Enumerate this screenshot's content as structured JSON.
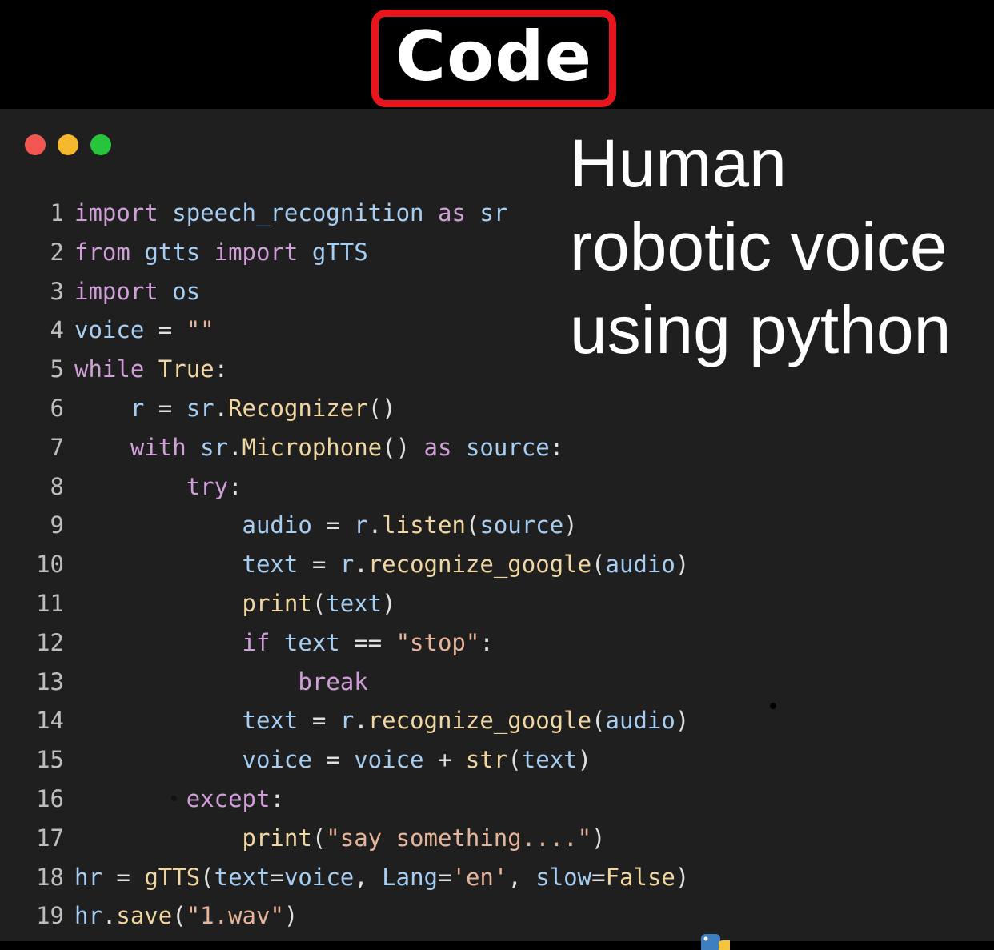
{
  "header": {
    "title": "Code"
  },
  "window": {
    "controls": [
      "close",
      "minimize",
      "maximize"
    ],
    "control_colors": {
      "close": "#f25651",
      "minimize": "#f4b82d",
      "maximize": "#27c53c"
    }
  },
  "caption": {
    "line1": "Human",
    "line2": "robotic voice",
    "line3": "using python"
  },
  "code": {
    "lines": [
      {
        "n": "1",
        "tokens": [
          [
            "k",
            "import"
          ],
          [
            "o",
            " "
          ],
          [
            "v",
            "speech_recognition"
          ],
          [
            "o",
            " "
          ],
          [
            "k",
            "as"
          ],
          [
            "o",
            " "
          ],
          [
            "v",
            "sr"
          ]
        ]
      },
      {
        "n": "2",
        "tokens": [
          [
            "k",
            "from"
          ],
          [
            "o",
            " "
          ],
          [
            "v",
            "gtts"
          ],
          [
            "o",
            " "
          ],
          [
            "k",
            "import"
          ],
          [
            "o",
            " "
          ],
          [
            "v",
            "gTTS"
          ]
        ]
      },
      {
        "n": "3",
        "tokens": [
          [
            "k",
            "import"
          ],
          [
            "o",
            " "
          ],
          [
            "v",
            "os"
          ]
        ]
      },
      {
        "n": "4",
        "tokens": [
          [
            "v",
            "voice"
          ],
          [
            "o",
            " = "
          ],
          [
            "s",
            "\"\""
          ]
        ]
      },
      {
        "n": "5",
        "tokens": [
          [
            "k",
            "while"
          ],
          [
            "o",
            " "
          ],
          [
            "f",
            "True"
          ],
          [
            "o",
            ":"
          ]
        ]
      },
      {
        "n": "6",
        "tokens": [
          [
            "o",
            "    "
          ],
          [
            "v",
            "r"
          ],
          [
            "o",
            " = "
          ],
          [
            "v",
            "sr"
          ],
          [
            "o",
            "."
          ],
          [
            "f",
            "Recognizer"
          ],
          [
            "o",
            "()"
          ]
        ]
      },
      {
        "n": "7",
        "tokens": [
          [
            "o",
            "    "
          ],
          [
            "k",
            "with"
          ],
          [
            "o",
            " "
          ],
          [
            "v",
            "sr"
          ],
          [
            "o",
            "."
          ],
          [
            "f",
            "Microphone"
          ],
          [
            "o",
            "() "
          ],
          [
            "k",
            "as"
          ],
          [
            "o",
            " "
          ],
          [
            "v",
            "source"
          ],
          [
            "o",
            ":"
          ]
        ]
      },
      {
        "n": "8",
        "tokens": [
          [
            "o",
            "        "
          ],
          [
            "k",
            "try"
          ],
          [
            "o",
            ":"
          ]
        ]
      },
      {
        "n": "9",
        "tokens": [
          [
            "o",
            "            "
          ],
          [
            "v",
            "audio"
          ],
          [
            "o",
            " = "
          ],
          [
            "v",
            "r"
          ],
          [
            "o",
            "."
          ],
          [
            "f",
            "listen"
          ],
          [
            "o",
            "("
          ],
          [
            "v",
            "source"
          ],
          [
            "o",
            ")"
          ]
        ]
      },
      {
        "n": "10",
        "tokens": [
          [
            "o",
            "            "
          ],
          [
            "v",
            "text"
          ],
          [
            "o",
            " = "
          ],
          [
            "v",
            "r"
          ],
          [
            "o",
            "."
          ],
          [
            "f",
            "recognize_google"
          ],
          [
            "o",
            "("
          ],
          [
            "v",
            "audio"
          ],
          [
            "o",
            ")"
          ]
        ]
      },
      {
        "n": "11",
        "tokens": [
          [
            "o",
            "            "
          ],
          [
            "f",
            "print"
          ],
          [
            "o",
            "("
          ],
          [
            "v",
            "text"
          ],
          [
            "o",
            ")"
          ]
        ]
      },
      {
        "n": "12",
        "tokens": [
          [
            "o",
            "            "
          ],
          [
            "k",
            "if"
          ],
          [
            "o",
            " "
          ],
          [
            "v",
            "text"
          ],
          [
            "o",
            " == "
          ],
          [
            "s",
            "\"stop\""
          ],
          [
            "o",
            ":"
          ]
        ]
      },
      {
        "n": "13",
        "tokens": [
          [
            "o",
            "                "
          ],
          [
            "k",
            "break"
          ]
        ]
      },
      {
        "n": "14",
        "tokens": [
          [
            "o",
            "            "
          ],
          [
            "v",
            "text"
          ],
          [
            "o",
            " = "
          ],
          [
            "v",
            "r"
          ],
          [
            "o",
            "."
          ],
          [
            "f",
            "recognize_google"
          ],
          [
            "o",
            "("
          ],
          [
            "v",
            "audio"
          ],
          [
            "o",
            ")"
          ]
        ]
      },
      {
        "n": "15",
        "tokens": [
          [
            "o",
            "            "
          ],
          [
            "v",
            "voice"
          ],
          [
            "o",
            " = "
          ],
          [
            "v",
            "voice"
          ],
          [
            "o",
            " + "
          ],
          [
            "f",
            "str"
          ],
          [
            "o",
            "("
          ],
          [
            "v",
            "text"
          ],
          [
            "o",
            ")"
          ]
        ]
      },
      {
        "n": "16",
        "tokens": [
          [
            "o",
            "        "
          ],
          [
            "k",
            "except"
          ],
          [
            "o",
            ":"
          ]
        ]
      },
      {
        "n": "17",
        "tokens": [
          [
            "o",
            "            "
          ],
          [
            "f",
            "print"
          ],
          [
            "o",
            "("
          ],
          [
            "s",
            "\"say something....\""
          ],
          [
            "o",
            ")"
          ]
        ]
      },
      {
        "n": "18",
        "tokens": [
          [
            "v",
            "hr"
          ],
          [
            "o",
            " = "
          ],
          [
            "f",
            "gTTS"
          ],
          [
            "o",
            "("
          ],
          [
            "v",
            "text"
          ],
          [
            "o",
            "="
          ],
          [
            "v",
            "voice"
          ],
          [
            "o",
            ", "
          ],
          [
            "v",
            "Lang"
          ],
          [
            "o",
            "="
          ],
          [
            "s",
            "'en'"
          ],
          [
            "o",
            ", "
          ],
          [
            "v",
            "slow"
          ],
          [
            "o",
            "="
          ],
          [
            "f",
            "False"
          ],
          [
            "o",
            ")"
          ]
        ]
      },
      {
        "n": "19",
        "tokens": [
          [
            "v",
            "hr"
          ],
          [
            "o",
            "."
          ],
          [
            "f",
            "save"
          ],
          [
            "o",
            "("
          ],
          [
            "s",
            "\"1.wav\""
          ],
          [
            "o",
            ")"
          ]
        ]
      }
    ]
  }
}
